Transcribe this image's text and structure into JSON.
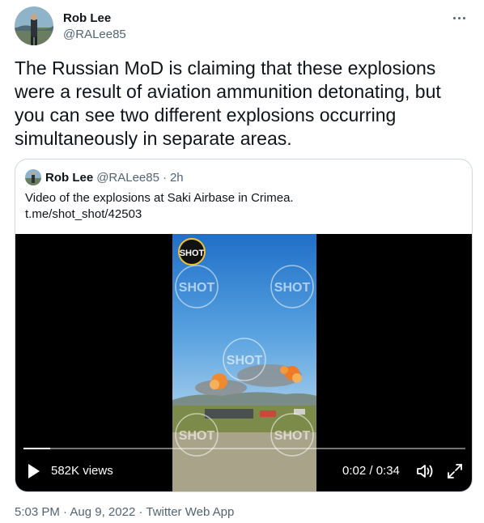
{
  "author": {
    "display_name": "Rob Lee",
    "handle": "@RALee85",
    "avatar_icon": "profile-photo"
  },
  "more_icon": "ellipsis-icon",
  "tweet": {
    "text": "The Russian MoD is claiming that these explosions were a result of aviation ammunition detonating, but you can see two different explosions occurring simultaneously in separate areas."
  },
  "quoted": {
    "display_name": "Rob Lee",
    "handle": "@RALee85",
    "separator": "·",
    "time": "2h",
    "text": "Video of the explosions at Saki Airbase in Crimea.",
    "link": "t.me/shot_shot/42503",
    "video": {
      "watermark": "SHOT",
      "views": "582K views",
      "time": "0:02 / 0:34",
      "progress": 0.06
    }
  },
  "meta": {
    "time": "5:03 PM",
    "sep1": "·",
    "date": "Aug 9, 2022",
    "sep2": "·",
    "source": "Twitter Web App"
  },
  "colors": {
    "text": "#0f1419",
    "secondary": "#536471",
    "border": "#cfd9de",
    "sky": "#3d8fd6",
    "fire": "#f07a28"
  }
}
